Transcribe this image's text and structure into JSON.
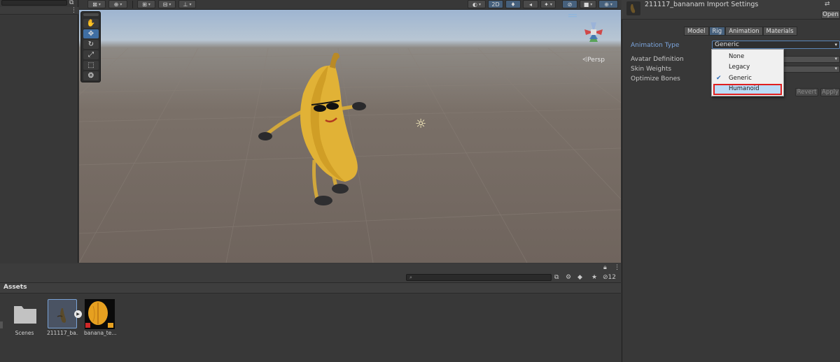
{
  "toolbar": {
    "mode_2d": "2D"
  },
  "scene": {
    "projection_label": "Persp"
  },
  "inspector": {
    "title": "211117_bananam Import Settings",
    "open_button": "Open",
    "tabs": [
      {
        "label": "Model"
      },
      {
        "label": "Rig"
      },
      {
        "label": "Animation"
      },
      {
        "label": "Materials"
      }
    ],
    "animation_type_label": "Animation Type",
    "animation_type_value": "Generic",
    "avatar_definition_label": "Avatar Definition",
    "skin_weights_label": "Skin Weights",
    "optimize_bones_label": "Optimize Bones",
    "revert_button": "Revert",
    "apply_button": "Apply",
    "dropdown_options": [
      {
        "label": "None"
      },
      {
        "label": "Legacy"
      },
      {
        "label": "Generic"
      },
      {
        "label": "Humanoid"
      }
    ]
  },
  "project": {
    "folder_label": "Assets",
    "hidden_count": "12",
    "assets": [
      {
        "name": "Scenes"
      },
      {
        "name": "211117_ba..."
      },
      {
        "name": "banana_te..."
      }
    ]
  },
  "colors": {
    "accent": "#46607c",
    "highlight_border": "#e02020",
    "dropdown_selected": "#bcdcf7"
  }
}
